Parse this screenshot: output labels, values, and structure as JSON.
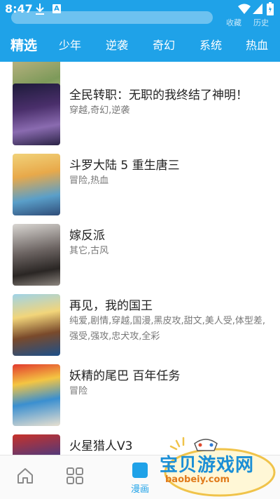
{
  "status_bar": {
    "time": "8:47",
    "a_badge": "A"
  },
  "header": {
    "right_links": [
      "收藏",
      "历史"
    ],
    "tabs": [
      {
        "label": "精选",
        "active": true
      },
      {
        "label": "少年",
        "active": false
      },
      {
        "label": "逆袭",
        "active": false
      },
      {
        "label": "奇幻",
        "active": false
      },
      {
        "label": "系统",
        "active": false
      },
      {
        "label": "热血",
        "active": false
      }
    ]
  },
  "comics": [
    {
      "title": "全民转职：无职的我终结了神明！",
      "tags": "穿越,奇幻,逆袭"
    },
    {
      "title": "斗罗大陆 5 重生唐三",
      "tags": "冒险,热血"
    },
    {
      "title": "嫁反派",
      "tags": "其它,古风"
    },
    {
      "title": "再见，我的国王",
      "tags": "纯爱,剧情,穿越,国漫,黑皮攻,甜文,美人受,体型差,强受,强攻,忠犬攻,全彩"
    },
    {
      "title": "妖精的尾巴 百年任务",
      "tags": "冒险"
    },
    {
      "title": "火星猎人V3",
      "tags": ""
    }
  ],
  "bottom_nav": [
    {
      "icon": "home-icon",
      "label": ""
    },
    {
      "icon": "grid-icon",
      "label": ""
    },
    {
      "icon": "manga-icon",
      "label": "漫画",
      "active": true
    },
    {
      "icon": "discover-icon",
      "label": ""
    },
    {
      "icon": "person-icon",
      "label": ""
    }
  ],
  "watermark": {
    "title": "宝贝游戏网",
    "url": "baobeiy.com"
  },
  "colors": {
    "accent": "#1fa2e8",
    "watermark_blue": "#1b8fd6",
    "watermark_orange": "#e07a1a"
  }
}
